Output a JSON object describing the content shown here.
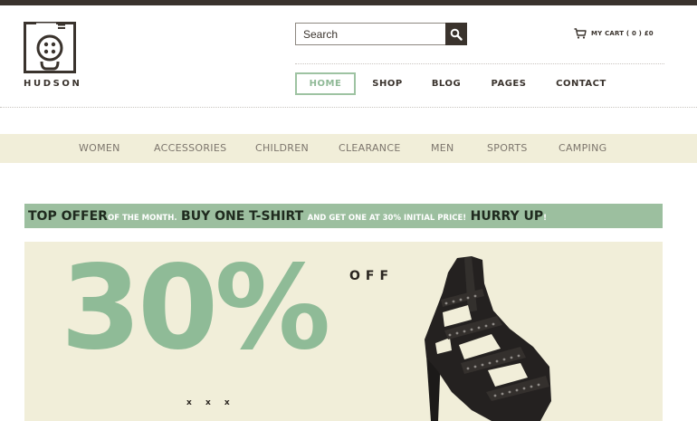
{
  "brand": {
    "name": "HUDSON"
  },
  "search": {
    "placeholder": "Search",
    "icon": "search-icon"
  },
  "cart": {
    "label": "MY CART",
    "count": "0",
    "total": "£0",
    "text": "MY CART ( 0 ) £0",
    "icon": "cart-icon"
  },
  "main_nav": {
    "items": [
      {
        "label": "HOME",
        "active": true
      },
      {
        "label": "SHOP"
      },
      {
        "label": "BLOG"
      },
      {
        "label": "PAGES"
      },
      {
        "label": "CONTACT"
      }
    ]
  },
  "categories": [
    "WOMEN",
    "ACCESSORIES",
    "CHILDREN",
    "CLEARANCE",
    "MEN",
    "SPORTS",
    "CAMPING"
  ],
  "offer": {
    "part1": "TOP OFFER",
    "part2": "OF THE MONTH.",
    "part3": "BUY ONE T-SHIRT",
    "part4": "AND GET ONE AT 30% INITIAL PRICE!",
    "part5": "HURRY UP",
    "part6": "!"
  },
  "hero": {
    "discount": "30%",
    "off_label": "OFF",
    "dots": "x x x",
    "image": "black-studded-ankle-boot"
  },
  "colors": {
    "dark": "#3a332d",
    "accent_green": "#8fbb97",
    "banner_green": "#9cbf9f",
    "cream": "#f1eed9"
  }
}
